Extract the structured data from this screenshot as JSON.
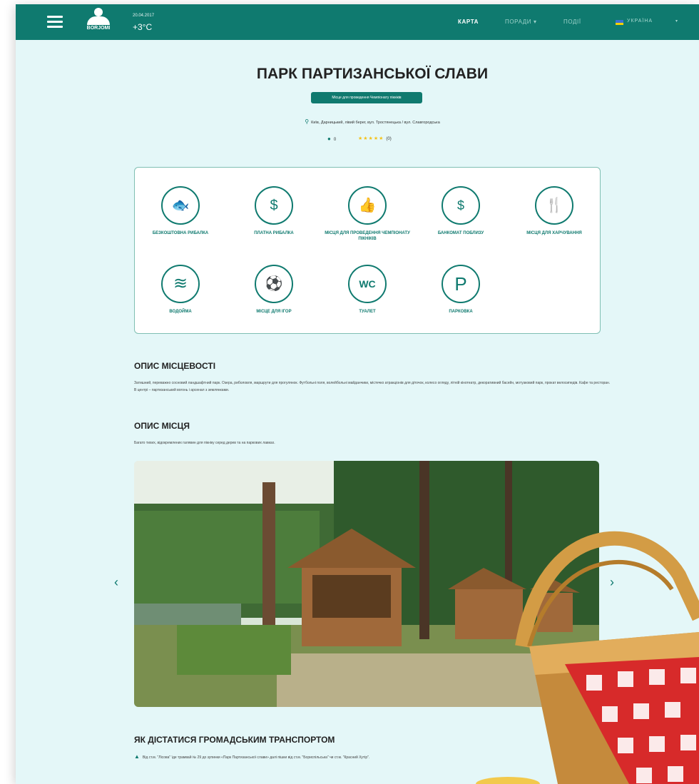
{
  "header": {
    "logo_text": "BORJOMI",
    "date": "20.04.2017",
    "temperature": "+3°C",
    "nav": [
      {
        "label": "КАРТА"
      },
      {
        "label": "ПОРАДИ ▾"
      },
      {
        "label": "ПОДІЇ"
      }
    ],
    "language": "УКРАЇНА",
    "language_caret": "▾"
  },
  "page": {
    "title": "ПАРК ПАРТИЗАНСЬКОЇ СЛАВИ",
    "badge": "Місце для проведення Чемпіонату пікніків",
    "address": "Київ, Дарницький, лівий берег, вул. Тростянецька / вул. Славгородська",
    "comments_count": "0",
    "rating": 5,
    "rating_count": "(0)"
  },
  "amenities": [
    {
      "icon": "fish-icon",
      "glyph": "🐟",
      "label": "БЕЗКОШТОВНА РИБАЛКА"
    },
    {
      "icon": "paid-fishing-icon",
      "glyph": "$",
      "label": "ПЛАТНА РИБАЛКА"
    },
    {
      "icon": "thumbs-up-icon",
      "glyph": "👍",
      "label": "МІСЦЯ ДЛЯ ПРОВЕДЕННЯ ЧЕМПІОНАТУ ПІКНІКІВ"
    },
    {
      "icon": "atm-icon",
      "glyph": "$",
      "label": "БАНКОМАТ ПОБЛИЗУ"
    },
    {
      "icon": "food-icon",
      "glyph": "🍴",
      "label": "МІСЦЯ ДЛЯ ХАРЧУВАННЯ"
    },
    {
      "icon": "water-icon",
      "glyph": "≋",
      "label": "ВОДОЙМА"
    },
    {
      "icon": "games-icon",
      "glyph": "⚽",
      "label": "МІСЦЕ ДЛЯ ІГОР"
    },
    {
      "icon": "wc-icon",
      "glyph": "WC",
      "label": "ТУАЛЕТ"
    },
    {
      "icon": "parking-icon",
      "glyph": "P",
      "label": "ПАРКОВКА"
    }
  ],
  "sections": {
    "area": {
      "title": "ОПИС МІСЦЕВОСТІ",
      "text": "Затишний, переважно сосновий ландшафтний парк. Озера, риболовля, маршрути для прогулянок. Футбольні поля, волейбольні майданчики, містечко атракціонів для діточок, колесо огляду, літній кінотеатр, декоративний басейн, мотузковий парк, прокат велосипедів. Кафе та ресторан. В центрі – партизанський вогонь і арсенал з землянками."
    },
    "place": {
      "title": "ОПИС МІСЦЯ",
      "text": "Багато тихих, відокремлених галявин для пікніку серед дерев та на паркових лавках."
    },
    "transport": {
      "title": "ЯК ДІСТАТИСЯ ГРОМАДСЬКИМ ТРАНСПОРТОМ",
      "text": "Від ст.м. \"Лісова\" їде трамвай № 29 до зупинки «Парк Партизанської слави» далі пішки від ст.м. \"Бориспільська\" чи ст.м. \"Красний Хутір\"."
    }
  },
  "carousel": {
    "prev": "‹",
    "next": "›"
  },
  "colors": {
    "brand": "#0f7a6f",
    "background": "#e4f7f8",
    "star": "#f4c21a"
  }
}
